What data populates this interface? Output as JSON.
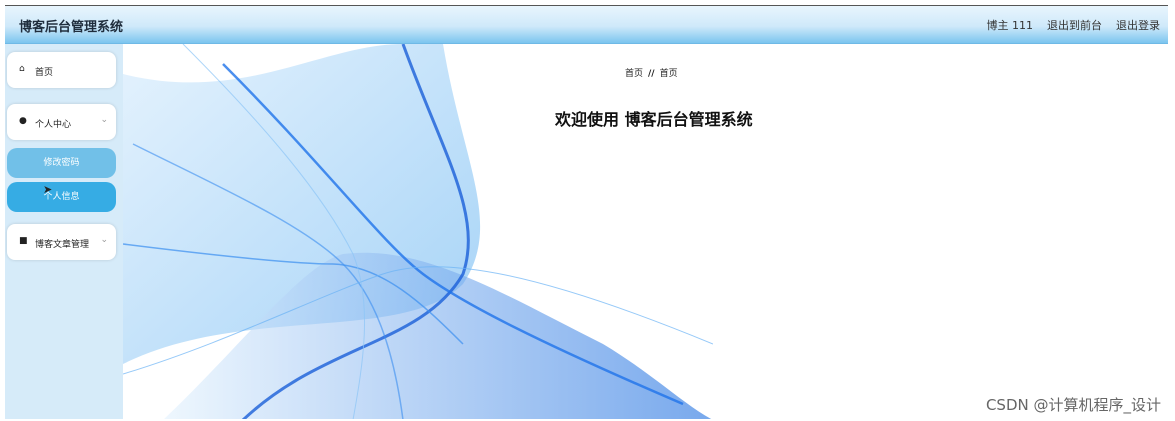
{
  "header": {
    "brand": "博客后台管理系统",
    "user_label": "博主 111",
    "to_frontend": "退出到前台",
    "logout": "退出登录"
  },
  "sidebar": {
    "items": [
      {
        "label": "首页",
        "icon": "home-icon"
      },
      {
        "label": "个人中心",
        "icon": "user-icon",
        "expanded": true,
        "children": [
          {
            "label": "修改密码"
          },
          {
            "label": "个人信息"
          }
        ]
      },
      {
        "label": "博客文章管理",
        "icon": "article-icon"
      }
    ]
  },
  "breadcrumb": {
    "parent": "首页",
    "separator": "//",
    "current": "首页"
  },
  "main": {
    "welcome": "欢迎使用 博客后台管理系统"
  },
  "watermark": "CSDN @计算机程序_设计",
  "colors": {
    "accent": "#36ace4",
    "submenu_active": "#71c0e8",
    "sidebar_bg": "#d6ebf9",
    "wave": "#1a73e8"
  }
}
